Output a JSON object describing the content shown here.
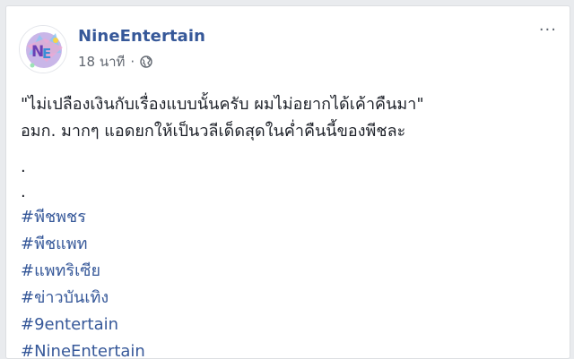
{
  "post": {
    "page_name": "NineEntertain",
    "timestamp": "18 นาที",
    "meta_separator": "·",
    "more_label": "···",
    "body_lines": [
      "\"ไม่เปลืองเงินกับเรื่องแบบนั้นครับ ผมไม่อยากได้เค้าคืนมา\"",
      "อมก. มากๆ แอดยกให้เป็นวลีเด็ดสุดในค่ำคืนนี้ของพีชละ"
    ],
    "spacer_dots": [
      ".",
      "."
    ],
    "hashtags": [
      "#พีชพชร",
      "#พีชแพท",
      "#แพทริเซีย",
      "#ข่าวบันเทิง",
      "#9entertain",
      "#NineEntertain"
    ]
  },
  "icons": {
    "avatar": "nineentertain-logo-avatar",
    "globe": "globe-icon",
    "more": "more-options-icon"
  },
  "colors": {
    "link_blue": "#365899",
    "text": "#1d2129",
    "meta_gray": "#616770",
    "background": "#e9ebee",
    "card": "#ffffff"
  }
}
